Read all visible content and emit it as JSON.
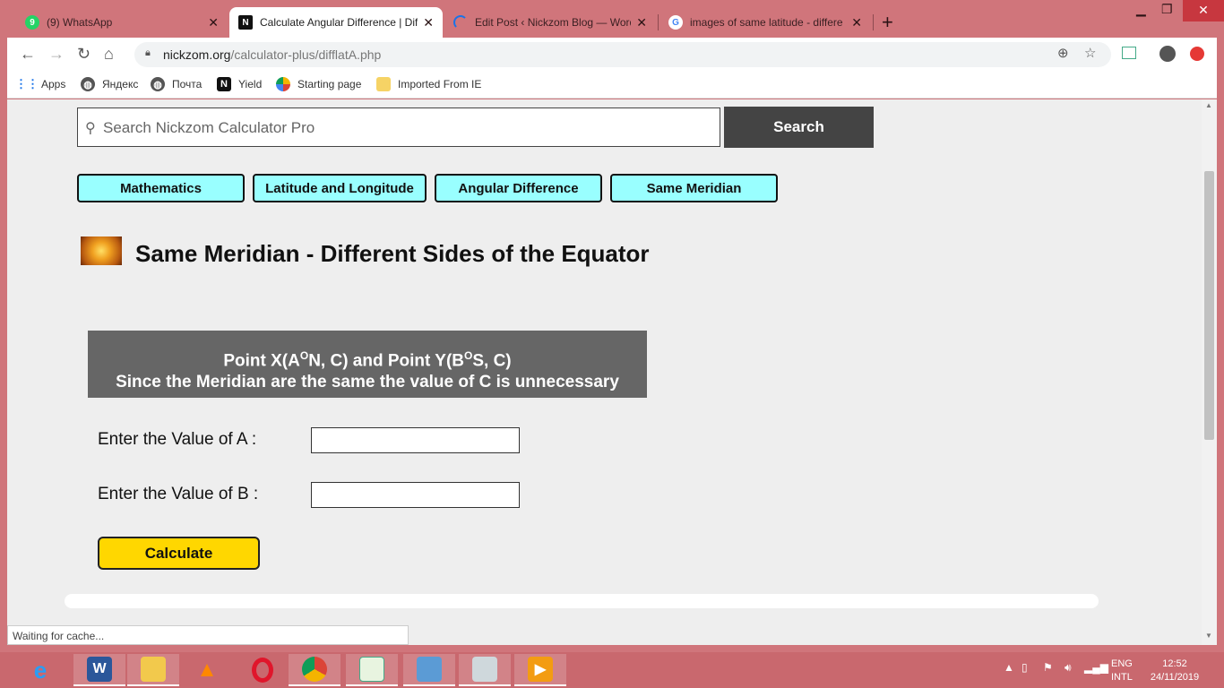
{
  "browser": {
    "tabs": [
      {
        "title": "(9) WhatsApp",
        "icon": "whatsapp-icon"
      },
      {
        "title": "Calculate Angular Difference | Dif",
        "icon": "nickzom-icon"
      },
      {
        "title": "Edit Post ‹ Nickzom Blog — Word",
        "icon": "loading-icon"
      },
      {
        "title": "images of same latitude - differe",
        "icon": "google-icon"
      }
    ],
    "url_host": "nickzom.org",
    "url_path": "/calculator-plus/difflatA.php",
    "bookmarks": [
      {
        "label": "Apps",
        "icon": "apps-grid-icon"
      },
      {
        "label": "Яндекс",
        "icon": "globe-icon"
      },
      {
        "label": "Почта",
        "icon": "globe-icon"
      },
      {
        "label": "Yield",
        "icon": "notion-icon"
      },
      {
        "label": "Starting page",
        "icon": "starting-page-icon"
      },
      {
        "label": "Imported From IE",
        "icon": "folder-icon"
      }
    ],
    "status": "Waiting for cache..."
  },
  "page": {
    "search_placeholder": "Search Nickzom Calculator Pro",
    "search_button": "Search",
    "nav": [
      "Mathematics",
      "Latitude and Longitude",
      "Angular Difference",
      "Same Meridian"
    ],
    "title": "Same Meridian - Different Sides of the Equator",
    "banner": {
      "line1_p1": "Point X(A",
      "line1_sup1": "O",
      "line1_p2": "N, C) and Point Y(B",
      "line1_sup2": "O",
      "line1_p3": "S, C)",
      "line2": "Since the Meridian are the same the value of C is unnecessary"
    },
    "label_a": "Enter the Value of A :",
    "label_b": "Enter the Value of B :",
    "calculate": "Calculate"
  },
  "taskbar": {
    "lang_top": "ENG",
    "lang_bottom": "INTL",
    "time": "12:52",
    "date": "24/11/2019"
  },
  "colors": {
    "nav_pill": "#99ffff",
    "calc_button": "#ffd700",
    "banner": "#666666",
    "search_button": "#444444",
    "chrome_frame": "#d0757b"
  }
}
